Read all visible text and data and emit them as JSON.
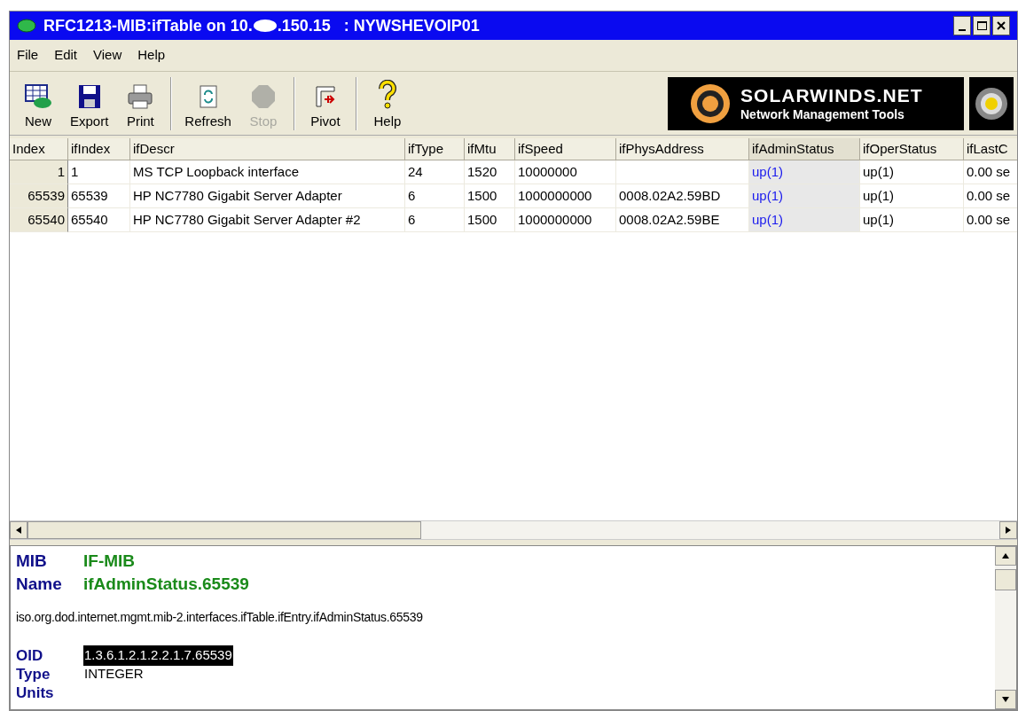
{
  "window": {
    "title_start": "RFC1213-MIB:ifTable on 10.",
    "title_end": ".150.15   : NYWSHEVOIP01"
  },
  "menu": [
    "File",
    "Edit",
    "View",
    "Help"
  ],
  "toolbar": [
    {
      "label": "New",
      "kind": "new",
      "disabled": false
    },
    {
      "label": "Export",
      "kind": "export",
      "disabled": false
    },
    {
      "label": "Print",
      "kind": "print",
      "disabled": false
    },
    {
      "kind": "separator"
    },
    {
      "label": "Refresh",
      "kind": "refresh",
      "disabled": false
    },
    {
      "label": "Stop",
      "kind": "stop",
      "disabled": true
    },
    {
      "kind": "separator"
    },
    {
      "label": "Pivot",
      "kind": "pivot",
      "disabled": false
    },
    {
      "kind": "separator"
    },
    {
      "label": "Help",
      "kind": "help",
      "disabled": false
    }
  ],
  "logo": {
    "name": "SOLARWINDS.NET",
    "tagline": "Network Management Tools"
  },
  "table": {
    "columns": [
      {
        "label": "Index",
        "selected": false
      },
      {
        "label": "ifIndex",
        "selected": false
      },
      {
        "label": "ifDescr",
        "selected": false
      },
      {
        "label": "ifType",
        "selected": false
      },
      {
        "label": "ifMtu",
        "selected": false
      },
      {
        "label": "ifSpeed",
        "selected": false
      },
      {
        "label": "ifPhysAddress",
        "selected": false
      },
      {
        "label": "ifAdminStatus",
        "selected": true
      },
      {
        "label": "ifOperStatus",
        "selected": false
      },
      {
        "label": "ifLastC",
        "selected": false
      }
    ],
    "rows": [
      [
        "1",
        "1",
        "MS TCP Loopback interface",
        "24",
        "1520",
        "10000000",
        "",
        "up(1)",
        "up(1)",
        "0.00 se"
      ],
      [
        "65539",
        "65539",
        "HP NC7780 Gigabit Server Adapter",
        "6",
        "1500",
        "1000000000",
        "0008.02A2.59BD",
        "up(1)",
        "up(1)",
        "0.00 se"
      ],
      [
        "65540",
        "65540",
        "HP NC7780 Gigabit Server Adapter #2",
        "6",
        "1500",
        "1000000000",
        "0008.02A2.59BE",
        "up(1)",
        "up(1)",
        "0.00 se"
      ]
    ]
  },
  "details": {
    "mib_label": "MIB",
    "mib": "IF-MIB",
    "name_label": "Name",
    "name": "ifAdminStatus.65539",
    "path": "iso.org.dod.internet.mgmt.mib-2.interfaces.ifTable.ifEntry.ifAdminStatus.65539",
    "fields": [
      {
        "label": "OID",
        "value": "1.3.6.1.2.1.2.2.1.7.65539",
        "selected": true
      },
      {
        "label": "Type",
        "value": "INTEGER",
        "selected": false
      },
      {
        "label": "Units"
      }
    ]
  }
}
